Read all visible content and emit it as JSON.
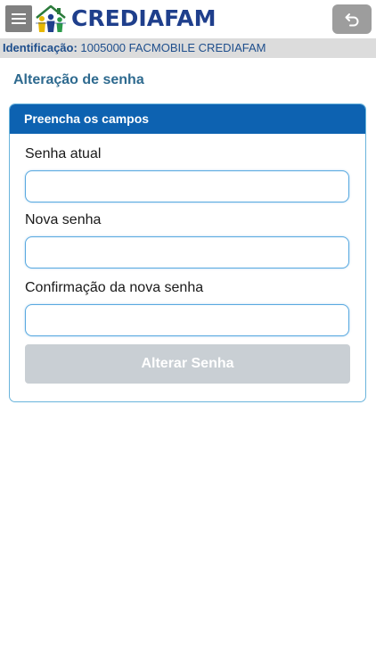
{
  "app": {
    "brand": "CREDIAFAM",
    "menu_icon": "hamburger-menu-icon",
    "back_icon": "undo-arrow-icon"
  },
  "identification": {
    "label": "Identificação:",
    "value": "1005000 FACMOBILE CREDIAFAM"
  },
  "page": {
    "title": "Alteração de senha"
  },
  "form": {
    "header": "Preencha os campos",
    "fields": [
      {
        "label": "Senha atual",
        "value": "",
        "placeholder": ""
      },
      {
        "label": "Nova senha",
        "value": "",
        "placeholder": ""
      },
      {
        "label": "Confirmação da nova senha",
        "value": "",
        "placeholder": ""
      }
    ],
    "submit_label": "Alterar Senha",
    "submit_enabled": false
  },
  "colors": {
    "brand_blue": "#1f3f8c",
    "panel_header": "#0d62b1",
    "input_border": "#59a9e0",
    "disabled_button": "#c9cfd4",
    "id_bar_bg": "#dcdcdc"
  }
}
